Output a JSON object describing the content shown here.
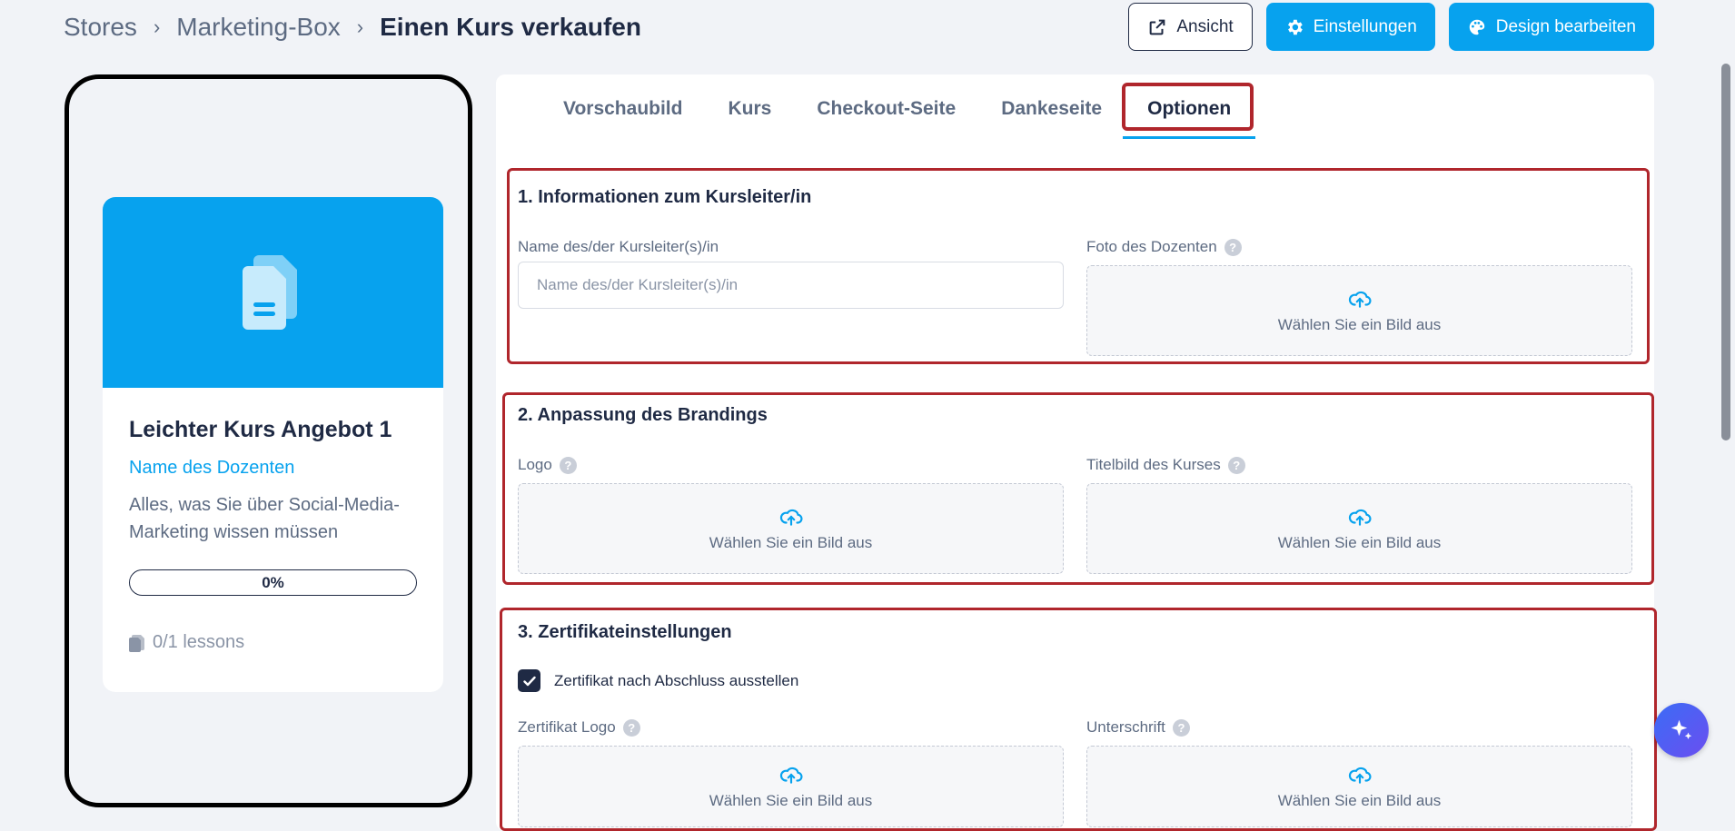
{
  "breadcrumb": {
    "items": [
      "Stores",
      "Marketing-Box",
      "Einen Kurs verkaufen"
    ]
  },
  "actions": {
    "view": "Ansicht",
    "settings": "Einstellungen",
    "design": "Design bearbeiten"
  },
  "preview": {
    "title": "Leichter Kurs Angebot 1",
    "teacher": "Name des Dozenten",
    "description": "Alles, was Sie über Social-Media-Marketing wissen müssen",
    "progress": "0%",
    "lessons": "0/1 lessons"
  },
  "tabs": [
    "Vorschaubild",
    "Kurs",
    "Checkout-Seite",
    "Dankeseite",
    "Optionen"
  ],
  "active_tab": "Optionen",
  "sections": {
    "teacher": {
      "title": "1. Informationen zum Kursleiter/in",
      "name_label": "Name des/der Kursleiter(s)/in",
      "name_placeholder": "Name des/der Kursleiter(s)/in",
      "photo_label": "Foto des Dozenten"
    },
    "branding": {
      "title": "2. Anpassung des Brandings",
      "logo_label": "Logo",
      "cover_label": "Titelbild des Kurses"
    },
    "certificate": {
      "title": "3. Zertifikateinstellungen",
      "issue_label": "Zertifikat nach Abschluss ausstellen",
      "issue_checked": true,
      "logo_label": "Zertifikat Logo",
      "signature_label": "Unterschrift"
    }
  },
  "upload_text": "Wählen Sie ein Bild aus",
  "colors": {
    "accent": "#07a2ee",
    "dark": "#1f2a44",
    "highlight": "#b0262c"
  }
}
